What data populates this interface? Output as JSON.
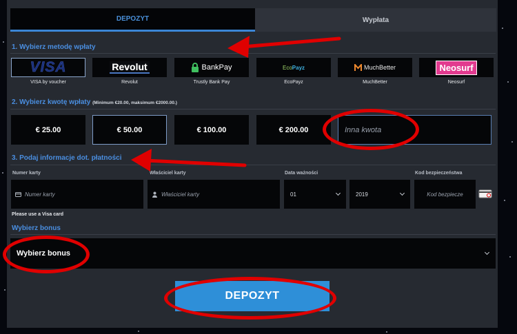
{
  "tabs": {
    "deposit": "DEPOZYT",
    "withdraw": "Wypłata"
  },
  "section1": {
    "title": "1. Wybierz metodę wpłaty"
  },
  "methods": [
    {
      "logo": "VISA",
      "label": "VISA by voucher"
    },
    {
      "logo": "Revolut",
      "label": "Revolut"
    },
    {
      "logo": "BankPay",
      "label": "Trustly Bank Pay"
    },
    {
      "logo_a": "Eco",
      "logo_b": "Payz",
      "label": "EcoPayz"
    },
    {
      "logo": "MuchBetter",
      "label": "MuchBetter"
    },
    {
      "logo": "Neosurf",
      "label": "Neosurf"
    }
  ],
  "section2": {
    "title": "2. Wybierz kwotę wpłaty",
    "limits": "(Minimum €20.00, maksimum €2000.00.)"
  },
  "amounts": [
    "€ 25.00",
    "€ 50.00",
    "€ 100.00",
    "€ 200.00"
  ],
  "custom_amount": {
    "placeholder": "Inna kwota",
    "value": ""
  },
  "section3": {
    "title": "3. Podaj informacje dot. płatności"
  },
  "card": {
    "number_label": "Numer karty",
    "number_placeholder": "Numer karty",
    "holder_label": "Właściciel karty",
    "holder_placeholder": "Właściciel karty",
    "expiry_label": "Data ważności",
    "month": "01",
    "year": "2019",
    "cvv_label": "Kod bezpieczeństwa",
    "cvv_placeholder": "Kod bezpiecze",
    "note": "Please use a Visa card"
  },
  "bonus": {
    "title": "Wybierz bonus",
    "selected": "Wybierz bonus"
  },
  "submit": {
    "label": "DEPOZYT"
  },
  "colors": {
    "accent": "#3b86d6",
    "annotation": "#e00000",
    "button": "#2e8fd8"
  }
}
